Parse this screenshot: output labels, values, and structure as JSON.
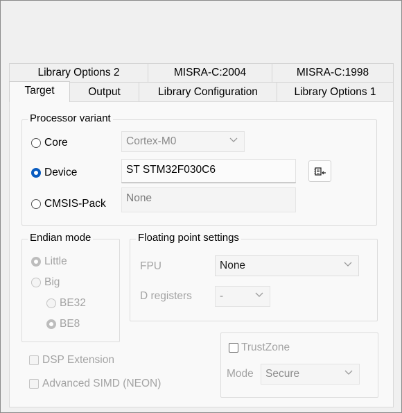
{
  "tabs": {
    "row_back": [
      {
        "label": "Library Options 2"
      },
      {
        "label": "MISRA-C:2004"
      },
      {
        "label": "MISRA-C:1998"
      }
    ],
    "row_front": [
      {
        "label": "Target"
      },
      {
        "label": "Output"
      },
      {
        "label": "Library Configuration"
      },
      {
        "label": "Library Options 1"
      }
    ],
    "active": "Target"
  },
  "processor_variant": {
    "legend": "Processor variant",
    "core_label": "Core",
    "core_value": "Cortex-M0",
    "device_label": "Device",
    "device_value": "ST STM32F030C6",
    "cmsis_label": "CMSIS-Pack",
    "cmsis_value": "None",
    "selected": "Device",
    "device_select_icon": "select-device-icon"
  },
  "endian_mode": {
    "legend": "Endian mode",
    "little_label": "Little",
    "big_label": "Big",
    "be32_label": "BE32",
    "be8_label": "BE8"
  },
  "floating_point": {
    "legend": "Floating point settings",
    "fpu_label": "FPU",
    "fpu_value": "None",
    "dreg_label": "D registers",
    "dreg_value": "-"
  },
  "trustzone": {
    "label": "TrustZone",
    "mode_label": "Mode",
    "mode_value": "Secure"
  },
  "dsp_extension_label": "DSP Extension",
  "advanced_simd_label": "Advanced SIMD (NEON)",
  "colors": {
    "accent": "#0a5cc0",
    "disabled_text": "#a3a3a3"
  }
}
